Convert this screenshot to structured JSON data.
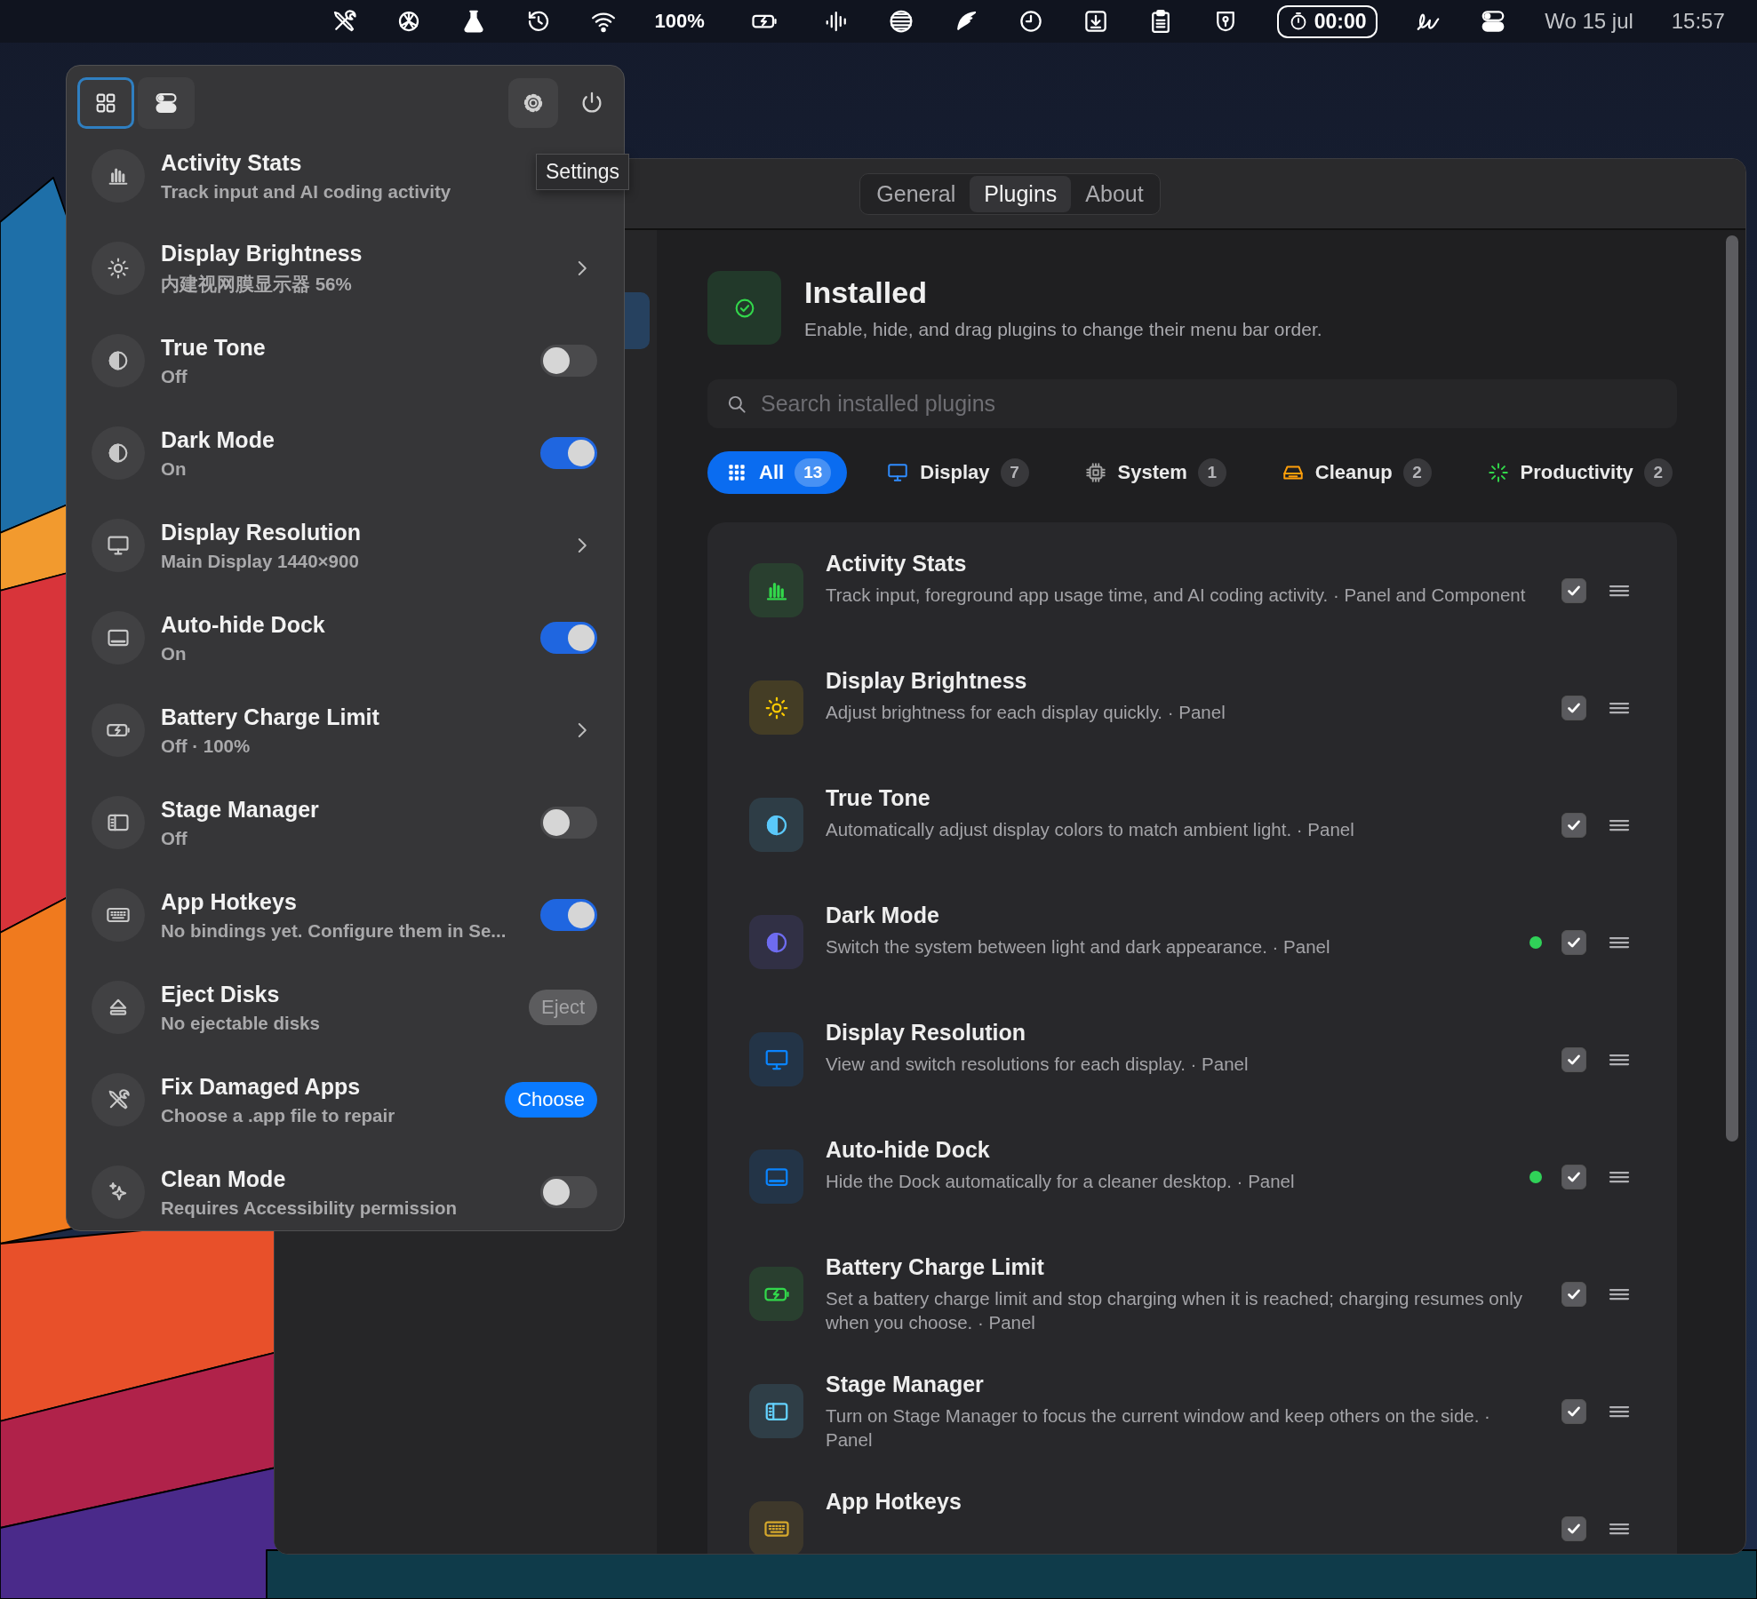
{
  "menu_bar": {
    "battery_percent": "100%",
    "timer": "00:00",
    "date": "Wo 15 jul",
    "time": "15:57"
  },
  "popover": {
    "view_switch": [
      {
        "selected": true
      },
      {
        "selected": false
      }
    ],
    "items": [
      {
        "kind": "plain",
        "title": "Activity Stats",
        "subtitle": "Track input and AI coding activity"
      },
      {
        "kind": "chevron",
        "title": "Display Brightness",
        "subtitle": "内建视网膜显示器 56%"
      },
      {
        "kind": "toggle",
        "title": "True Tone",
        "subtitle": "Off",
        "on": false
      },
      {
        "kind": "toggle",
        "title": "Dark Mode",
        "subtitle": "On",
        "on": true
      },
      {
        "kind": "chevron",
        "title": "Display Resolution",
        "subtitle": "Main Display 1440×900"
      },
      {
        "kind": "toggle",
        "title": "Auto-hide Dock",
        "subtitle": "On",
        "on": true
      },
      {
        "kind": "chevron",
        "title": "Battery Charge Limit",
        "subtitle": "Off · 100%"
      },
      {
        "kind": "toggle",
        "title": "Stage Manager",
        "subtitle": "Off",
        "on": false
      },
      {
        "kind": "toggle",
        "title": "App Hotkeys",
        "subtitle": "No bindings yet. Configure them in Se...",
        "on": true
      },
      {
        "kind": "button",
        "title": "Eject Disks",
        "subtitle": "No ejectable disks",
        "button": "Eject",
        "disabled": true
      },
      {
        "kind": "button",
        "title": "Fix Damaged Apps",
        "subtitle": "Choose a .app file to repair",
        "button": "Choose",
        "disabled": false
      },
      {
        "kind": "toggle",
        "title": "Clean Mode",
        "subtitle": "Requires Accessibility permission",
        "on": false
      }
    ]
  },
  "tooltip": "Settings",
  "settings": {
    "tabs": [
      {
        "label": "General",
        "selected": false
      },
      {
        "label": "Plugins",
        "selected": true
      },
      {
        "label": "About",
        "selected": false
      }
    ],
    "header": {
      "title": "Installed",
      "subtitle": "Enable, hide, and drag plugins to change their menu bar order."
    },
    "search": {
      "placeholder": "Search installed plugins"
    },
    "filters": [
      {
        "label": "All",
        "count": "13",
        "selected": true,
        "color": "#ffffff"
      },
      {
        "label": "Display",
        "count": "7",
        "selected": false,
        "color": "#2f8cff"
      },
      {
        "label": "System",
        "count": "1",
        "selected": false,
        "color": "#a0a0a0"
      },
      {
        "label": "Cleanup",
        "count": "2",
        "selected": false,
        "color": "#ff9f0a"
      },
      {
        "label": "Productivity",
        "count": "2",
        "selected": false,
        "color": "#32d74b"
      }
    ],
    "plugins": [
      {
        "title": "Activity Stats",
        "description": "Track input, foreground app usage time, and AI coding activity. · Panel and Component",
        "color": "#32d74b",
        "active": false,
        "checked": true
      },
      {
        "title": "Display Brightness",
        "description": "Adjust brightness for each display quickly. · Panel",
        "color": "#ffcc00",
        "active": false,
        "checked": true
      },
      {
        "title": "True Tone",
        "description": "Automatically adjust display colors to match ambient light. · Panel",
        "color": "#5ac8fa",
        "active": false,
        "checked": true
      },
      {
        "title": "Dark Mode",
        "description": "Switch the system between light and dark appearance. · Panel",
        "color": "#6e6cf0",
        "active": true,
        "checked": true
      },
      {
        "title": "Display Resolution",
        "description": "View and switch resolutions for each display. · Panel",
        "color": "#0a84ff",
        "active": false,
        "checked": true
      },
      {
        "title": "Auto-hide Dock",
        "description": "Hide the Dock automatically for a cleaner desktop. · Panel",
        "color": "#0a84ff",
        "active": true,
        "checked": true
      },
      {
        "title": "Battery Charge Limit",
        "description": "Set a battery charge limit and stop charging when it is reached; charging resumes only when you choose. · Panel",
        "color": "#32d74b",
        "active": false,
        "checked": true
      },
      {
        "title": "Stage Manager",
        "description": "Turn on Stage Manager to focus the current window and keep others on the side. · Panel",
        "color": "#64d2ff",
        "active": false,
        "checked": true
      },
      {
        "title": "App Hotkeys",
        "color": "#d4a72c",
        "active": false,
        "checked": true
      }
    ]
  }
}
